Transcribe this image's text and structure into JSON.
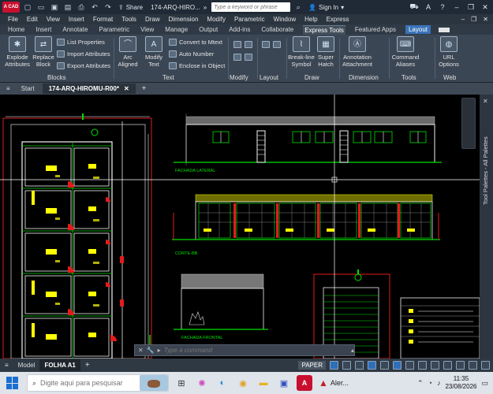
{
  "titlebar": {
    "logo_text": "A CAD",
    "share_label": "Share",
    "doc_title": "174-ARQ-HIRO...",
    "search_placeholder": "Type a keyword or phrase",
    "signin_label": "Sign In"
  },
  "menubar": {
    "items": [
      "File",
      "Edit",
      "View",
      "Insert",
      "Format",
      "Tools",
      "Draw",
      "Dimension",
      "Modify",
      "Parametric",
      "Window",
      "Help",
      "Express"
    ]
  },
  "ribbon_tabs": [
    "Home",
    "Insert",
    "Annotate",
    "Parametric",
    "View",
    "Manage",
    "Output",
    "Add-ins",
    "Collaborate",
    "Express Tools",
    "Featured Apps",
    "Layout"
  ],
  "ribbon": {
    "explode": "Explode Attributes",
    "replace": "Replace Block",
    "list_props": "List Properties",
    "import_attr": "Import Attributes",
    "export_attr": "Export Attributes",
    "arc_aligned": "Arc Aligned",
    "modify_text": "Modify Text",
    "convert_mtext": "Convert to Mtext",
    "auto_number": "Auto Number",
    "enclose": "Enclose in Object",
    "break_line": "Break-line Symbol",
    "super_hatch": "Super Hatch",
    "annotation": "Annotation Attachment",
    "command_aliases": "Command Aliases",
    "url_options": "URL Options",
    "panels": {
      "blocks": "Blocks",
      "text": "Text",
      "modify": "Modify",
      "layout": "Layout",
      "draw": "Draw",
      "dimension": "Dimension",
      "tools": "Tools",
      "web": "Web"
    }
  },
  "doctabs": {
    "start": "Start",
    "active": "174-ARQ-HIROMU-R00*"
  },
  "drawing": {
    "label_fachada_lateral": "FACHADA LATERAL",
    "label_corte": "CORTE-BB",
    "label_fachada_frontal": "FACHADA FRONTAL"
  },
  "tool_palettes_label": "Tool Palettes - All Palettes",
  "command": {
    "placeholder": "Type a command"
  },
  "statusbar": {
    "model": "Model",
    "layout": "FOLHA A1",
    "paper": "PAPER"
  },
  "taskbar": {
    "search_placeholder": "Digite aqui para pesquisar",
    "alert_label": "Aler...",
    "time": "11:35",
    "date": "23/08/2026"
  }
}
